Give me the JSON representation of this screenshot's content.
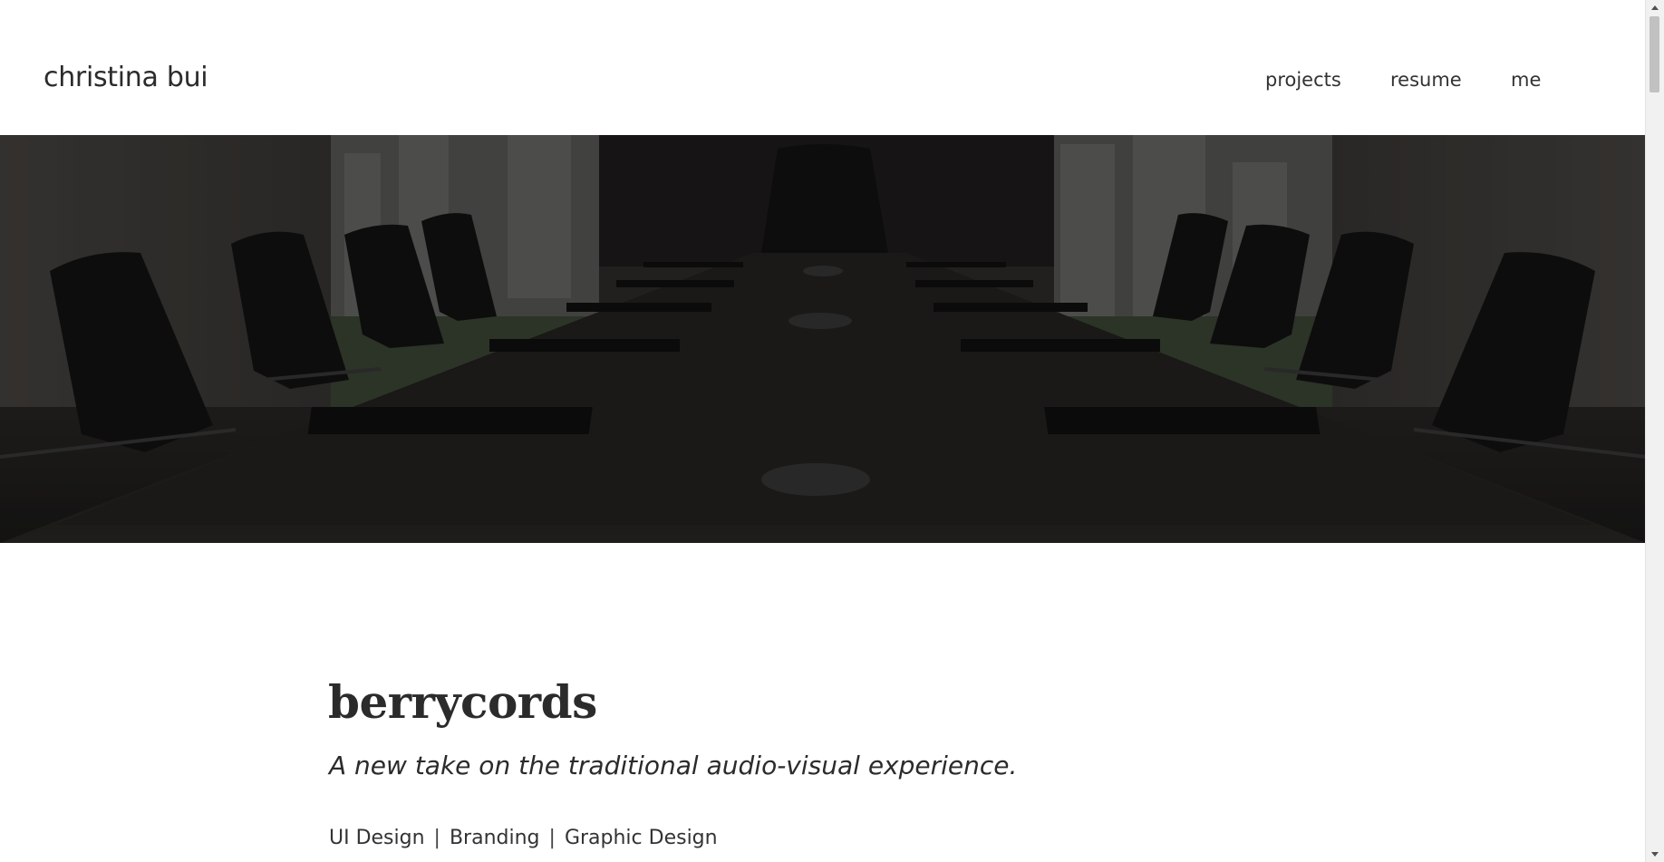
{
  "header": {
    "site_title": "christina bui",
    "nav": [
      {
        "label": "projects"
      },
      {
        "label": "resume"
      },
      {
        "label": "me"
      }
    ]
  },
  "hero": {
    "image": "boardroom-conference-table-photo",
    "overlay_color": "#000000"
  },
  "project": {
    "title": "berrycords",
    "tagline": "A new take on the traditional audio-visual experience.",
    "tags": [
      "UI Design",
      "Branding",
      "Graphic Design"
    ],
    "tag_separator": "|"
  },
  "scrollbar": {
    "thumb_color": "#c1c1c1",
    "track_color": "#f1f1f1"
  }
}
